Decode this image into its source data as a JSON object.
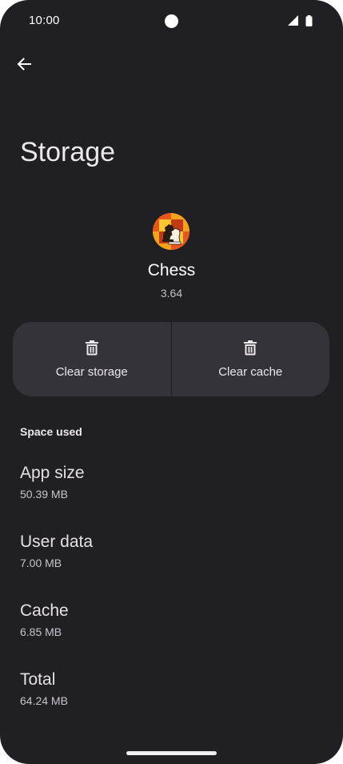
{
  "status_bar": {
    "time": "10:00"
  },
  "header": {
    "title": "Storage"
  },
  "app": {
    "name": "Chess",
    "version": "3.64"
  },
  "actions": {
    "clear_storage_label": "Clear storage",
    "clear_cache_label": "Clear cache"
  },
  "space_used": {
    "header": "Space used",
    "rows": [
      {
        "title": "App size",
        "value": "50.39 MB"
      },
      {
        "title": "User data",
        "value": "7.00 MB"
      },
      {
        "title": "Cache",
        "value": "6.85 MB"
      },
      {
        "title": "Total",
        "value": "64.24 MB"
      }
    ]
  },
  "icons": {
    "back": "arrow-back-icon",
    "delete": "trash-icon",
    "signal": "signal-icon",
    "battery": "battery-icon",
    "app": "chess-app-icon"
  },
  "colors": {
    "background": "#1f1f24",
    "button_surface": "#34333a",
    "text_primary": "#e6e1e6"
  }
}
